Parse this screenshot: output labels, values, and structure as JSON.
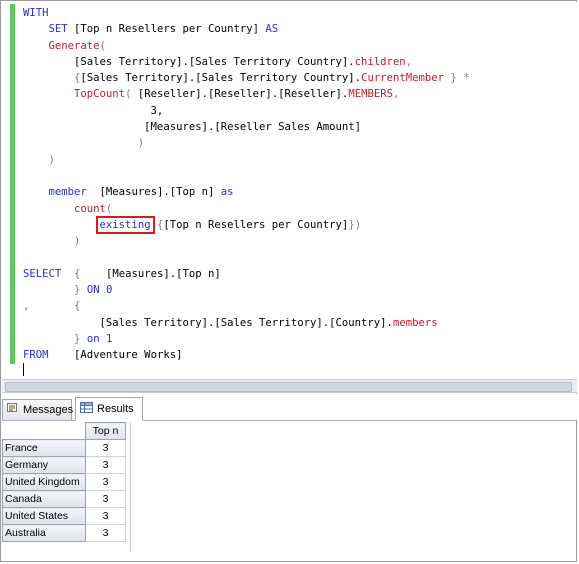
{
  "editor": {
    "lines": [
      {
        "segments": [
          {
            "t": "WITH",
            "c": "kw"
          }
        ]
      },
      {
        "segments": [
          {
            "t": "    "
          },
          {
            "t": "SET",
            "c": "kw"
          },
          {
            "t": " [Top n Resellers per Country] "
          },
          {
            "t": "AS",
            "c": "kw"
          }
        ]
      },
      {
        "segments": [
          {
            "t": "    "
          },
          {
            "t": "Generate",
            "c": "fn"
          },
          {
            "t": "(",
            "c": "gr"
          }
        ]
      },
      {
        "segments": [
          {
            "t": "        [Sales Territory].[Sales Territory Country]."
          },
          {
            "t": "children",
            "c": "fn"
          },
          {
            "t": ",",
            "c": "gr"
          }
        ]
      },
      {
        "segments": [
          {
            "t": "        "
          },
          {
            "t": "{",
            "c": "gr"
          },
          {
            "t": "[Sales Territory].[Sales Territory Country]."
          },
          {
            "t": "CurrentMember",
            "c": "fn"
          },
          {
            "t": " } *",
            "c": "gr"
          }
        ]
      },
      {
        "segments": [
          {
            "t": "        "
          },
          {
            "t": "TopCount",
            "c": "fn"
          },
          {
            "t": "(",
            "c": "gr"
          },
          {
            "t": " [Reseller].[Reseller].[Reseller]."
          },
          {
            "t": "MEMBERS",
            "c": "fn"
          },
          {
            "t": ",",
            "c": "gr"
          }
        ]
      },
      {
        "segments": [
          {
            "t": "                    3,"
          }
        ]
      },
      {
        "segments": [
          {
            "t": "                   [Measures].[Reseller Sales Amount]"
          }
        ]
      },
      {
        "segments": [
          {
            "t": "                  )",
            "c": "gr"
          }
        ]
      },
      {
        "segments": [
          {
            "t": "    )",
            "c": "gr"
          }
        ]
      },
      {
        "segments": [
          {
            "t": ""
          }
        ]
      },
      {
        "segments": [
          {
            "t": "    "
          },
          {
            "t": "member",
            "c": "kw"
          },
          {
            "t": "  [Measures].[Top n] "
          },
          {
            "t": "as",
            "c": "kw"
          }
        ]
      },
      {
        "segments": [
          {
            "t": "        "
          },
          {
            "t": "count",
            "c": "fn"
          },
          {
            "t": "(",
            "c": "gr"
          }
        ]
      },
      {
        "segments": [
          {
            "t": "            "
          },
          {
            "t": "existing",
            "c": "kw",
            "hl": true
          },
          {
            "t": " {",
            "c": "gr"
          },
          {
            "t": "[Top n Resellers per Country]"
          },
          {
            "t": "}",
            "c": "gr"
          },
          {
            "t": ")",
            "c": "gr"
          }
        ]
      },
      {
        "segments": [
          {
            "t": "        )",
            "c": "gr"
          }
        ]
      },
      {
        "segments": [
          {
            "t": ""
          }
        ]
      },
      {
        "segments": [
          {
            "t": "SELECT",
            "c": "kw"
          },
          {
            "t": "  "
          },
          {
            "t": "{",
            "c": "gr"
          },
          {
            "t": "    [Measures].[Top n]"
          }
        ]
      },
      {
        "segments": [
          {
            "t": "        "
          },
          {
            "t": "}",
            "c": "gr"
          },
          {
            "t": " "
          },
          {
            "t": "ON",
            "c": "kw"
          },
          {
            "t": " "
          },
          {
            "t": "0",
            "c": "kw"
          }
        ]
      },
      {
        "segments": [
          {
            "t": ",",
            "c": "gr"
          },
          {
            "t": "       "
          },
          {
            "t": "{",
            "c": "gr"
          }
        ]
      },
      {
        "segments": [
          {
            "t": "            [Sales Territory].[Sales Territory].[Country]."
          },
          {
            "t": "members",
            "c": "fn"
          }
        ]
      },
      {
        "segments": [
          {
            "t": "        "
          },
          {
            "t": "}",
            "c": "gr"
          },
          {
            "t": " "
          },
          {
            "t": "on",
            "c": "kw"
          },
          {
            "t": " "
          },
          {
            "t": "1",
            "c": "kw"
          }
        ]
      },
      {
        "segments": [
          {
            "t": "FROM",
            "c": "kw"
          },
          {
            "t": "    [Adventure Works]"
          }
        ]
      }
    ]
  },
  "tabs": {
    "messages_label": "Messages",
    "messages_icon": "messages-icon",
    "results_label": "Results",
    "results_icon": "grid-icon"
  },
  "results": {
    "column_header": "Top n",
    "rows": [
      {
        "country": "France",
        "value": "3"
      },
      {
        "country": "Germany",
        "value": "3"
      },
      {
        "country": "United Kingdom",
        "value": "3"
      },
      {
        "country": "Canada",
        "value": "3"
      },
      {
        "country": "United States",
        "value": "3"
      },
      {
        "country": "Australia",
        "value": "3"
      }
    ]
  },
  "colors": {
    "keyword": "#2b2bd6",
    "function": "#c0202a",
    "highlight_box": "#d31d1d",
    "change_bar": "#5fc75f"
  }
}
